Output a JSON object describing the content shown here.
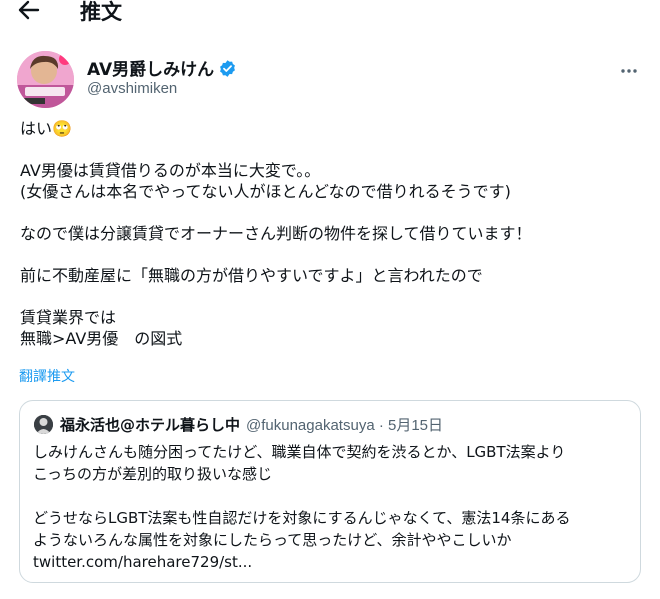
{
  "header": {
    "back_icon": "arrow-left-icon",
    "title": "推文"
  },
  "tweet": {
    "author_name": "AV男爵しみけん",
    "author_handle": "@avshimiken",
    "verified_icon": "verified-badge-icon",
    "verified_color": "#1d9bf0",
    "more_icon": "more-dots-icon",
    "text_lines": [
      "はい🙄",
      "",
      "AV男優は賃貸借りるのが本当に大変で。。",
      "(女優さんは本名でやってない人がほとんどなので借りれるそうです)",
      "",
      "なので僕は分譲賃貸でオーナーさん判断の物件を探して借りています！",
      "",
      "前に不動産屋に「無職の方が借りやすいですよ」と言われたので",
      "",
      "賃貸業界では",
      "無職>AV男優　の図式"
    ],
    "translate_label": "翻譯推文",
    "translate_color": "#1d9bf0"
  },
  "quoted_tweet": {
    "author_name": "福永活也@ホテル暮らし中",
    "author_handle": "@fukunagakatsuya · 5月15日",
    "text_lines": [
      "しみけんさんも随分困ってたけど、職業自体で契約を渋るとか、LGBT法案より",
      "こっちの方が差別的取り扱いな感じ",
      "",
      "どうせならLGBT法案も性自認だけを対象にするんじゃなくて、憲法14条にある",
      "ようないろんな属性を対象にしたらって思ったけど、余計ややこしいか",
      "twitter.com/harehare729/st..."
    ]
  }
}
